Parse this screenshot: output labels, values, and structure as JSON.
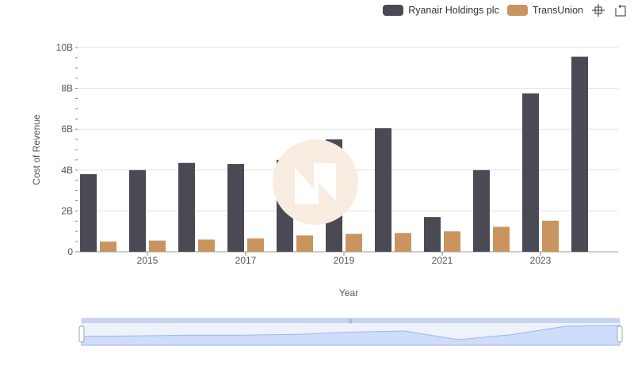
{
  "chart_data": {
    "type": "bar",
    "categories": [
      "2014",
      "2015",
      "2016",
      "2017",
      "2018",
      "2019",
      "2020",
      "2021",
      "2022",
      "2023",
      "2024"
    ],
    "x_tick_labels": [
      "2015",
      "2017",
      "2019",
      "2021",
      "2023"
    ],
    "series": [
      {
        "name": "Ryanair Holdings plc",
        "color": "#4a4a55",
        "values": [
          3.8,
          4.0,
          4.35,
          4.3,
          4.5,
          5.5,
          6.05,
          1.7,
          4.0,
          7.75,
          9.55
        ]
      },
      {
        "name": "TransUnion",
        "color": "#c99460",
        "values": [
          0.5,
          0.55,
          0.6,
          0.65,
          0.8,
          0.88,
          0.92,
          1.0,
          1.22,
          1.52,
          null
        ]
      }
    ],
    "xlabel": "Year",
    "ylabel": "Cost of Revenue",
    "ylim": [
      0,
      10
    ],
    "y_ticks": [
      "0",
      "2B",
      "4B",
      "6B",
      "8B",
      "10B"
    ],
    "grid": true,
    "legend_position": "top-right"
  },
  "toolbar": {
    "zoom_icon": "crosshair-zoom-icon",
    "reset_icon": "reset-zoom-icon"
  }
}
